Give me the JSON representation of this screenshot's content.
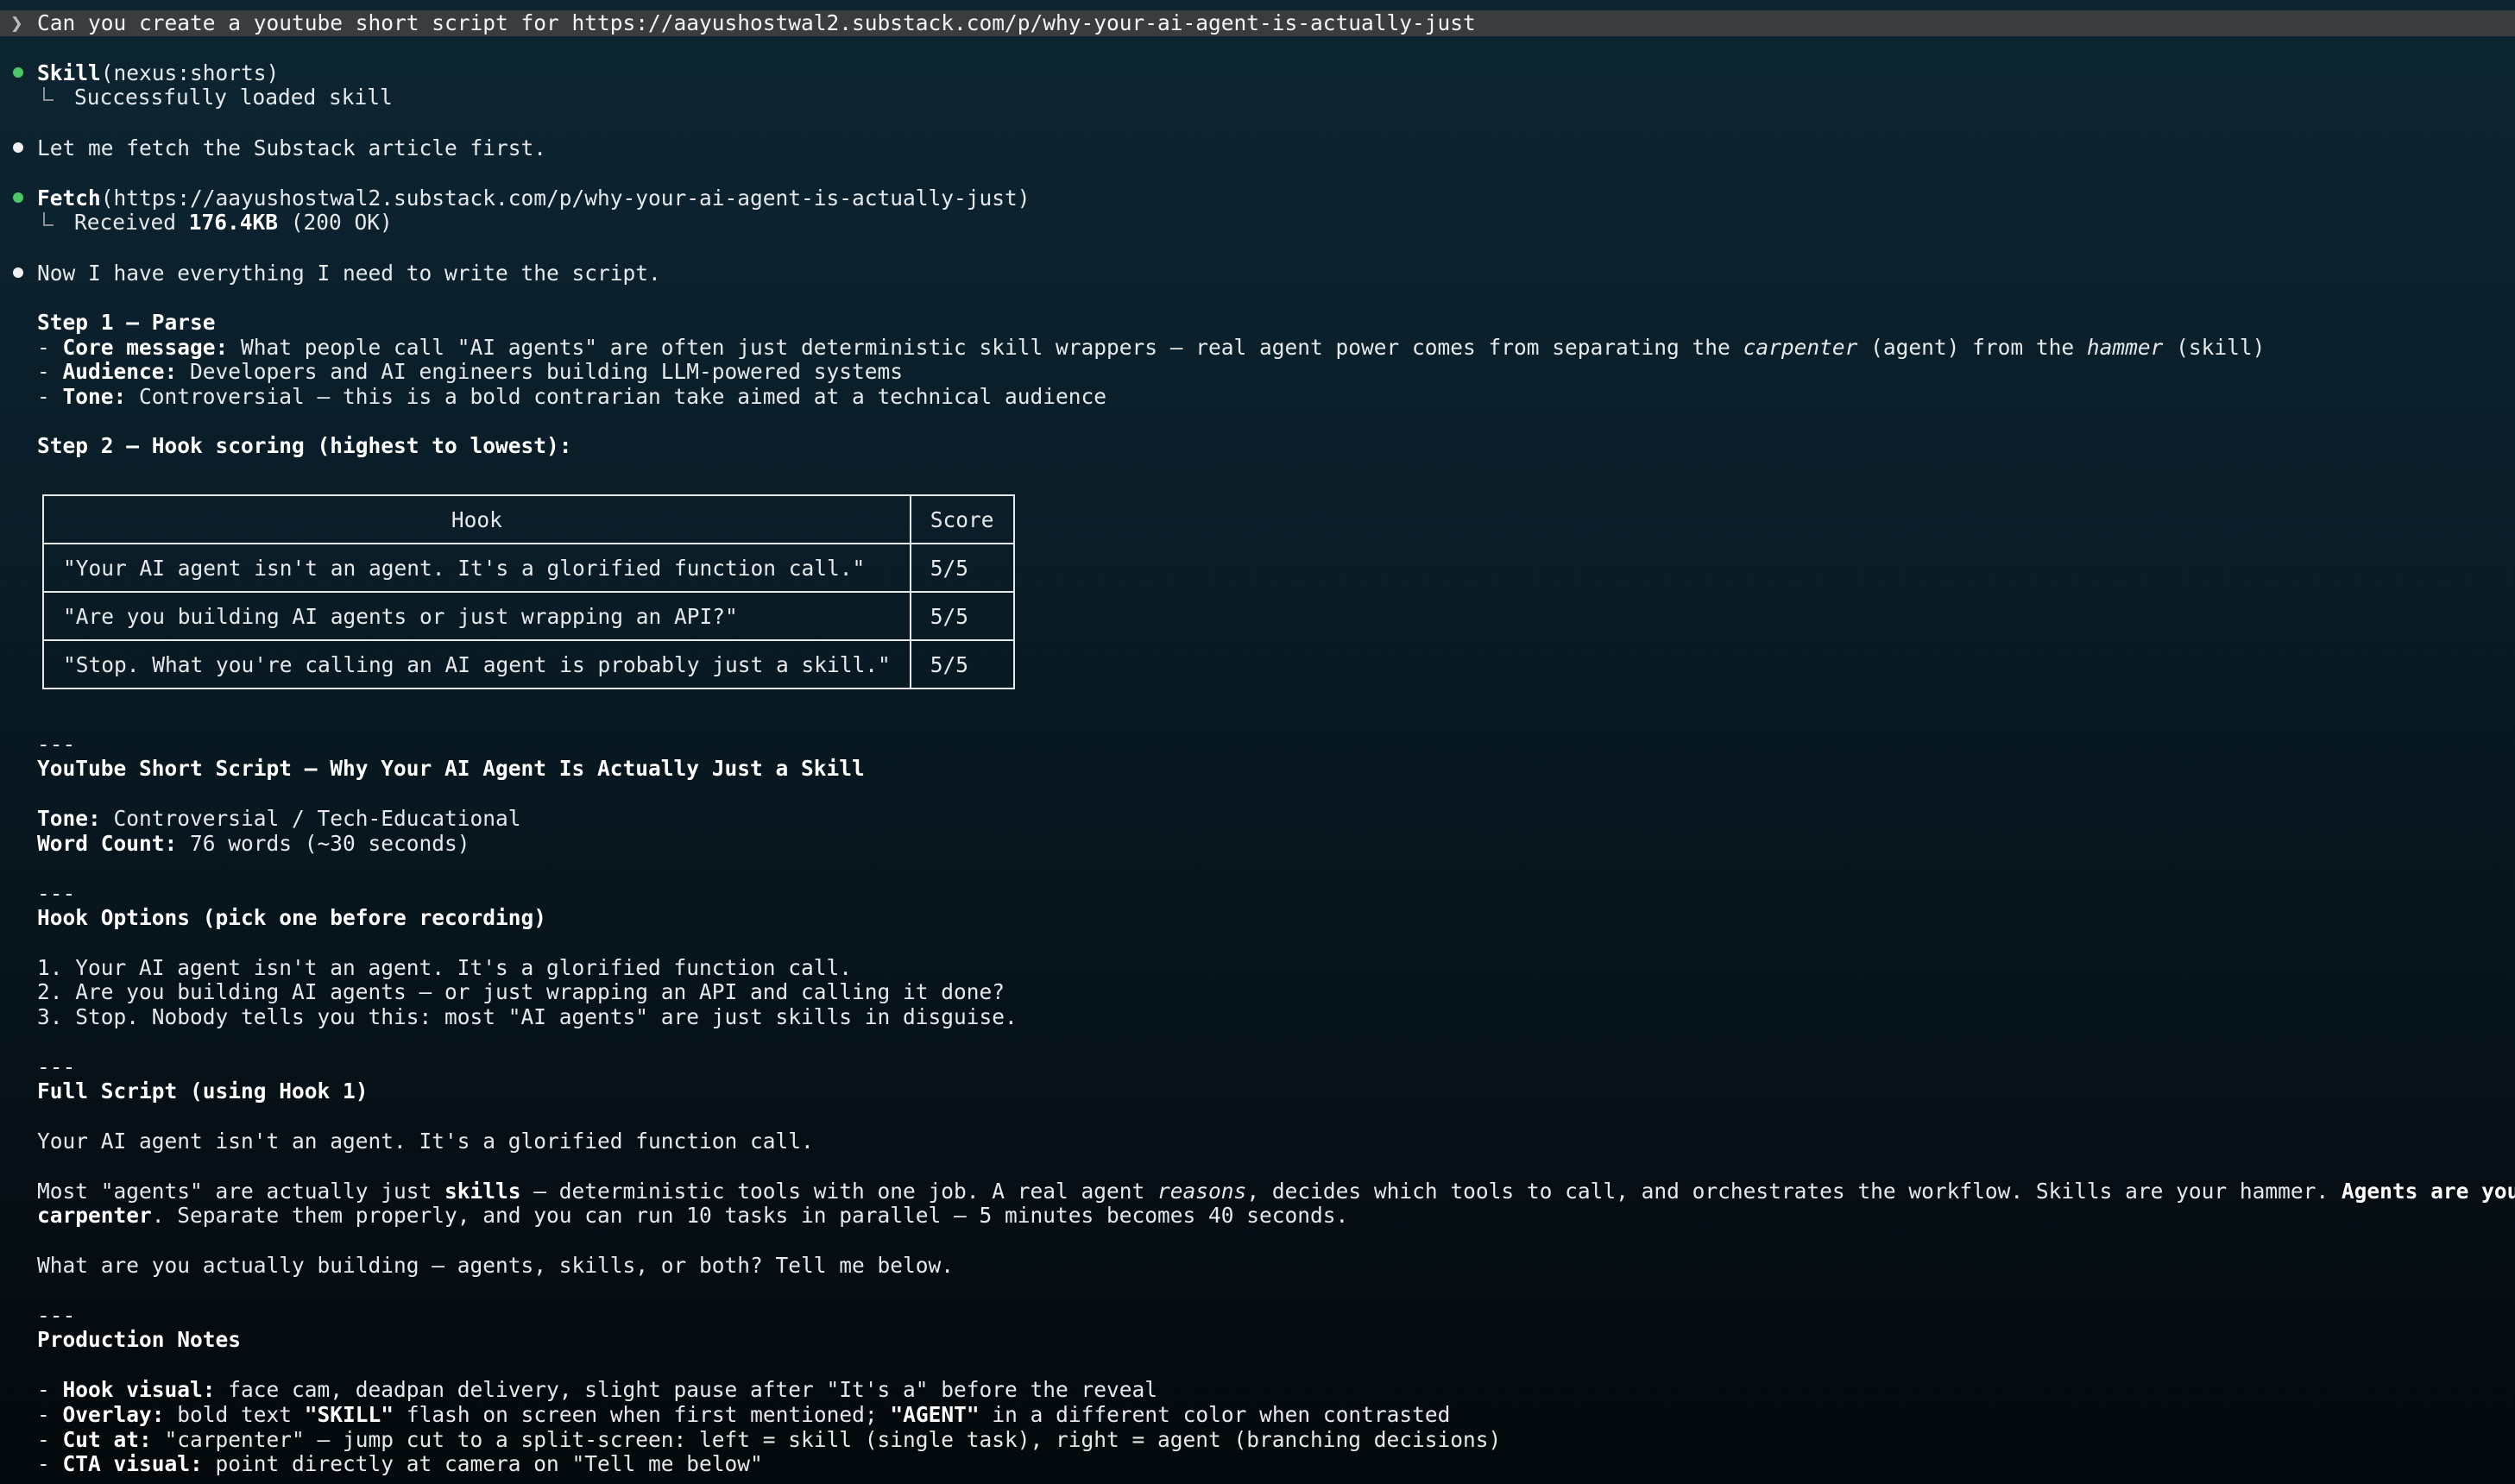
{
  "prompt": {
    "arrow": "❯",
    "text": "Can you create a youtube short script for https://aayushostwal2.substack.com/p/why-your-ai-agent-is-actually-just"
  },
  "skill_call": {
    "name": "Skill",
    "arg": "(nexus:shorts)",
    "result": "Successfully loaded skill"
  },
  "message_1": "Let me fetch the Substack article first.",
  "fetch_call": {
    "name": "Fetch",
    "arg": "(https://aayushostwal2.substack.com/p/why-your-ai-agent-is-actually-just)",
    "result_prefix": "Received ",
    "result_size": "176.4KB",
    "result_suffix": " (200 OK)"
  },
  "message_2": "Now I have everything I need to write the script.",
  "step1": {
    "heading": "Step 1 — Parse",
    "core_label": "Core message:",
    "core_text_a": " What people call \"AI agents\" are often just deterministic skill wrappers — real agent power comes from separating the ",
    "core_italic_1": "carpenter",
    "core_text_b": " (agent) from the ",
    "core_italic_2": "hammer",
    "core_text_c": " (skill)",
    "audience_label": "Audience:",
    "audience_text": " Developers and AI engineers building LLM-powered systems",
    "tone_label": "Tone:",
    "tone_text": " Controversial — this is a bold contrarian take aimed at a technical audience"
  },
  "step2": {
    "heading": "Step 2 — Hook scoring (highest to lowest):",
    "table": {
      "headers": [
        "Hook",
        "Score"
      ],
      "rows": [
        [
          "\"Your AI agent isn't an agent. It's a glorified function call.\"",
          "5/5"
        ],
        [
          "\"Are you building AI agents or just wrapping an API?\"",
          "5/5"
        ],
        [
          "\"Stop. What you're calling an AI agent is probably just a skill.\"",
          "5/5"
        ]
      ]
    }
  },
  "divider": "---",
  "script": {
    "title": "YouTube Short Script — Why Your AI Agent Is Actually Just a Skill",
    "tone_label": "Tone:",
    "tone_text": " Controversial / Tech-Educational",
    "wc_label": "Word Count:",
    "wc_text": " 76 words (~30 seconds)"
  },
  "hook_options": {
    "heading": "Hook Options (pick one before recording)",
    "items": [
      "1. Your AI agent isn't an agent. It's a glorified function call.",
      "2. Are you building AI agents — or just wrapping an API and calling it done?",
      "3. Stop. Nobody tells you this: most \"AI agents\" are just skills in disguise."
    ]
  },
  "full_script": {
    "heading": "Full Script (using Hook 1)",
    "p1": "Your AI agent isn't an agent. It's a glorified function call.",
    "p2_a": "Most \"agents\" are actually just ",
    "p2_skills": "skills",
    "p2_b": " — deterministic tools with one job. A real agent ",
    "p2_reasons": "reasons",
    "p2_c": ", decides which tools to call, and orchestrates the workflow. Skills are your hammer. ",
    "p2_agents": "Agents are your",
    "p2_carpenter": "carpenter",
    "p2_d": ". Separate them properly, and you can run 10 tasks in parallel — 5 minutes becomes 40 seconds.",
    "p3": "What are you actually building — agents, skills, or both? Tell me below."
  },
  "production": {
    "heading": "Production Notes",
    "hook_label": "Hook visual:",
    "hook_text": " face cam, deadpan delivery, slight pause after \"It's a\" before the reveal",
    "overlay_label": "Overlay:",
    "overlay_a": " bold text ",
    "overlay_skill": "\"SKILL\"",
    "overlay_b": " flash on screen when first mentioned; ",
    "overlay_agent": "\"AGENT\"",
    "overlay_c": " in a different color when contrasted",
    "cut_label": "Cut at:",
    "cut_text": " \"carpenter\" — jump cut to a split-screen: left = skill (single task), right = agent (branching decisions)",
    "cta_label": "CTA visual:",
    "cta_text": " point directly at camera on \"Tell me below\""
  }
}
